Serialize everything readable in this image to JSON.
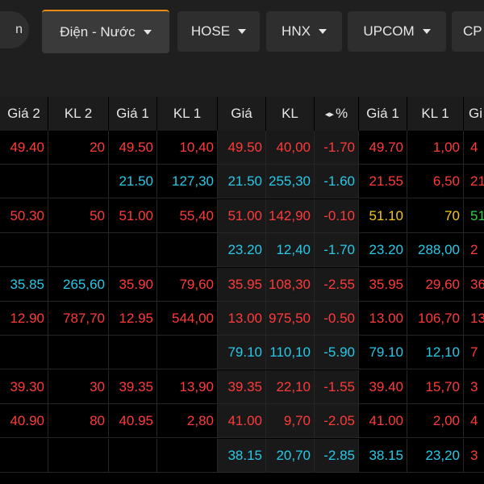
{
  "tabs": {
    "left_partial": "n",
    "items": [
      {
        "label": "Điện - Nước",
        "active": true
      },
      {
        "label": "HOSE"
      },
      {
        "label": "HNX"
      },
      {
        "label": "UPCOM"
      },
      {
        "label": "CP"
      }
    ]
  },
  "columns": [
    "Giá 2",
    "KL 2",
    "Giá 1",
    "KL 1",
    "Giá",
    "KL",
    "%",
    "Giá 1",
    "KL 1",
    "Gi"
  ],
  "pct_arrows": "◂▸",
  "rows": [
    {
      "cells": [
        {
          "v": "49.40",
          "c": "red"
        },
        {
          "v": "20",
          "c": "red"
        },
        {
          "v": "49.50",
          "c": "red"
        },
        {
          "v": "10,40",
          "c": "red"
        },
        {
          "v": "49.50",
          "c": "red"
        },
        {
          "v": "40,00",
          "c": "red"
        },
        {
          "v": "-1.70",
          "c": "red"
        },
        {
          "v": "49.70",
          "c": "red"
        },
        {
          "v": "1,00",
          "c": "red"
        },
        {
          "v": "4",
          "c": "red"
        }
      ]
    },
    {
      "cells": [
        {
          "v": "",
          "c": "red"
        },
        {
          "v": "",
          "c": "red"
        },
        {
          "v": "21.50",
          "c": "cyan"
        },
        {
          "v": "127,30",
          "c": "cyan"
        },
        {
          "v": "21.50",
          "c": "cyan"
        },
        {
          "v": "255,30",
          "c": "cyan"
        },
        {
          "v": "-1.60",
          "c": "cyan"
        },
        {
          "v": "21.55",
          "c": "red"
        },
        {
          "v": "6,50",
          "c": "red"
        },
        {
          "v": "21",
          "c": "red"
        }
      ]
    },
    {
      "cells": [
        {
          "v": "50.30",
          "c": "red"
        },
        {
          "v": "50",
          "c": "red"
        },
        {
          "v": "51.00",
          "c": "red"
        },
        {
          "v": "55,40",
          "c": "red"
        },
        {
          "v": "51.00",
          "c": "red"
        },
        {
          "v": "142,90",
          "c": "red"
        },
        {
          "v": "-0.10",
          "c": "red"
        },
        {
          "v": "51.10",
          "c": "yellow"
        },
        {
          "v": "70",
          "c": "yellow"
        },
        {
          "v": "51",
          "c": "green"
        }
      ]
    },
    {
      "cells": [
        {
          "v": "",
          "c": "red"
        },
        {
          "v": "",
          "c": "red"
        },
        {
          "v": "",
          "c": "red"
        },
        {
          "v": "",
          "c": "red"
        },
        {
          "v": "23.20",
          "c": "cyan"
        },
        {
          "v": "12,40",
          "c": "cyan"
        },
        {
          "v": "-1.70",
          "c": "cyan"
        },
        {
          "v": "23.20",
          "c": "cyan"
        },
        {
          "v": "288,00",
          "c": "cyan"
        },
        {
          "v": "2",
          "c": "red"
        }
      ]
    },
    {
      "cells": [
        {
          "v": "35.85",
          "c": "cyan"
        },
        {
          "v": "265,60",
          "c": "cyan"
        },
        {
          "v": "35.90",
          "c": "red"
        },
        {
          "v": "79,60",
          "c": "red"
        },
        {
          "v": "35.95",
          "c": "red"
        },
        {
          "v": "108,30",
          "c": "red"
        },
        {
          "v": "-2.55",
          "c": "red"
        },
        {
          "v": "35.95",
          "c": "red"
        },
        {
          "v": "29,60",
          "c": "red"
        },
        {
          "v": "36",
          "c": "red"
        }
      ]
    },
    {
      "cells": [
        {
          "v": "12.90",
          "c": "red"
        },
        {
          "v": "787,70",
          "c": "red"
        },
        {
          "v": "12.95",
          "c": "red"
        },
        {
          "v": "544,00",
          "c": "red"
        },
        {
          "v": "13.00",
          "c": "red"
        },
        {
          "v": "975,50",
          "c": "red"
        },
        {
          "v": "-0.50",
          "c": "red"
        },
        {
          "v": "13.00",
          "c": "red"
        },
        {
          "v": "106,70",
          "c": "red"
        },
        {
          "v": "13",
          "c": "red"
        }
      ]
    },
    {
      "cells": [
        {
          "v": "",
          "c": "red"
        },
        {
          "v": "",
          "c": "red"
        },
        {
          "v": "",
          "c": "red"
        },
        {
          "v": "",
          "c": "red"
        },
        {
          "v": "79.10",
          "c": "cyan"
        },
        {
          "v": "110,10",
          "c": "cyan"
        },
        {
          "v": "-5.90",
          "c": "cyan"
        },
        {
          "v": "79.10",
          "c": "cyan"
        },
        {
          "v": "12,10",
          "c": "cyan"
        },
        {
          "v": "7",
          "c": "red"
        }
      ]
    },
    {
      "cells": [
        {
          "v": "39.30",
          "c": "red"
        },
        {
          "v": "30",
          "c": "red"
        },
        {
          "v": "39.35",
          "c": "red"
        },
        {
          "v": "13,90",
          "c": "red"
        },
        {
          "v": "39.35",
          "c": "red"
        },
        {
          "v": "22,10",
          "c": "red"
        },
        {
          "v": "-1.55",
          "c": "red"
        },
        {
          "v": "39.40",
          "c": "red"
        },
        {
          "v": "15,70",
          "c": "red"
        },
        {
          "v": "3",
          "c": "red"
        }
      ]
    },
    {
      "cells": [
        {
          "v": "40.90",
          "c": "red"
        },
        {
          "v": "80",
          "c": "red"
        },
        {
          "v": "40.95",
          "c": "red"
        },
        {
          "v": "2,80",
          "c": "red"
        },
        {
          "v": "41.00",
          "c": "red"
        },
        {
          "v": "9,70",
          "c": "red"
        },
        {
          "v": "-2.05",
          "c": "red"
        },
        {
          "v": "41.00",
          "c": "red"
        },
        {
          "v": "2,00",
          "c": "red"
        },
        {
          "v": "4",
          "c": "red"
        }
      ]
    },
    {
      "cells": [
        {
          "v": "",
          "c": "red"
        },
        {
          "v": "",
          "c": "red"
        },
        {
          "v": "",
          "c": "red"
        },
        {
          "v": "",
          "c": "red"
        },
        {
          "v": "38.15",
          "c": "cyan"
        },
        {
          "v": "20,70",
          "c": "cyan"
        },
        {
          "v": "-2.85",
          "c": "cyan"
        },
        {
          "v": "38.15",
          "c": "cyan"
        },
        {
          "v": "23,20",
          "c": "cyan"
        },
        {
          "v": "3",
          "c": "red"
        }
      ]
    }
  ]
}
